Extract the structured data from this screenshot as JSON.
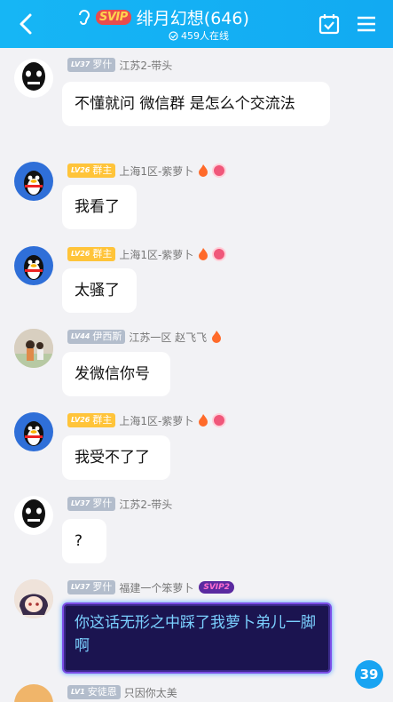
{
  "header": {
    "svip_label": "SVIP",
    "title": "绯月幻想(646)",
    "online": "459人在线"
  },
  "messages": [
    {
      "lv": "LV37",
      "role": "罗什",
      "info": "江苏2-带头",
      "text": "不懂就问  微信群 是怎么个交流法"
    },
    {
      "lv": "LV26",
      "role": "群主",
      "info": "上海1区-紫萝卜",
      "text": "我看了"
    },
    {
      "lv": "LV26",
      "role": "群主",
      "info": "上海1区-紫萝卜",
      "text": "太骚了"
    },
    {
      "lv": "LV44",
      "role": "伊西斯",
      "info": "江苏一区 赵飞飞",
      "text": "发微信你号"
    },
    {
      "lv": "LV26",
      "role": "群主",
      "info": "上海1区-紫萝卜",
      "text": "我受不了了"
    },
    {
      "lv": "LV37",
      "role": "罗什",
      "info": "江苏2-带头",
      "text": "?"
    },
    {
      "lv": "LV37",
      "role": "罗什",
      "info": "福建一个笨萝卜",
      "badge": "SVIP2",
      "text": "你这话无形之中踩了我萝卜弟儿一脚啊"
    },
    {
      "lv": "LV1",
      "role": "安徒恩",
      "info": "只因你太美"
    }
  ],
  "unread_count": "39",
  "colors": {
    "header": "#16b6f5",
    "background": "#f2f2f5",
    "gold_badge": "#ffc43a",
    "gray_badge": "#b3bdcc"
  }
}
